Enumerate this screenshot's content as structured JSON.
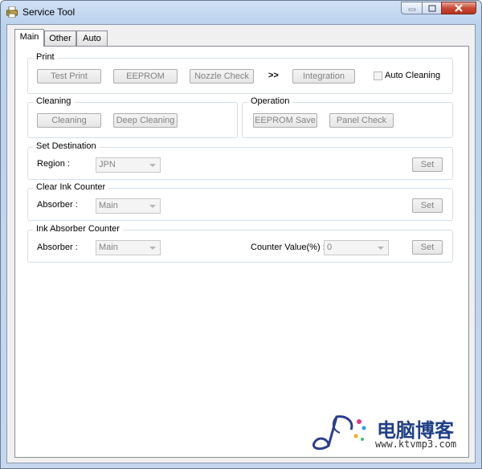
{
  "window": {
    "title": "Service Tool"
  },
  "tabs": [
    {
      "label": "Main",
      "active": true
    },
    {
      "label": "Other",
      "active": false
    },
    {
      "label": "Auto",
      "active": false
    }
  ],
  "print": {
    "legend": "Print",
    "test_print": "Test Print",
    "eeprom": "EEPROM",
    "nozzle_check": "Nozzle Check",
    "arrow": ">>",
    "integration": "Integration",
    "auto_cleaning": "Auto Cleaning",
    "auto_cleaning_checked": false
  },
  "cleaning": {
    "legend": "Cleaning",
    "cleaning": "Cleaning",
    "deep_cleaning": "Deep Cleaning"
  },
  "operation": {
    "legend": "Operation",
    "eeprom_save": "EEPROM Save",
    "panel_check": "Panel Check"
  },
  "set_destination": {
    "legend": "Set Destination",
    "region_label": "Region :",
    "region_value": "JPN",
    "set": "Set"
  },
  "clear_ink_counter": {
    "legend": "Clear Ink Counter",
    "absorber_label": "Absorber :",
    "absorber_value": "Main",
    "set": "Set"
  },
  "ink_absorber_counter": {
    "legend": "Ink Absorber Counter",
    "absorber_label": "Absorber :",
    "absorber_value": "Main",
    "counter_label": "Counter Value(%) :",
    "counter_value": "0",
    "set": "Set"
  },
  "watermark": {
    "title": "电脑博客",
    "url": "www.ktvmp3.com"
  }
}
